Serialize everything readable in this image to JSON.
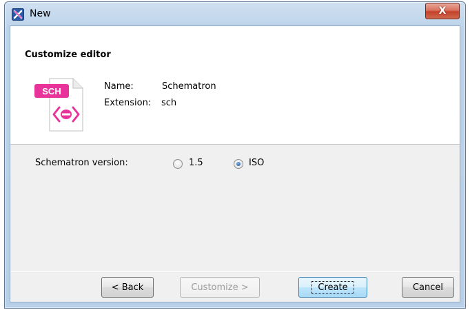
{
  "window": {
    "title": "New",
    "close_label": "X"
  },
  "header": {
    "title": "Customize editor",
    "icon_badge": "SCH",
    "name_label": "Name:",
    "name_value": "Schematron",
    "extension_label": "Extension:",
    "extension_value": "sch"
  },
  "options": {
    "version_label": "Schematron version:",
    "radios": [
      {
        "label": "1.5",
        "checked": false
      },
      {
        "label": "ISO",
        "checked": true
      }
    ]
  },
  "buttons": {
    "back": "< Back",
    "customize": "Customize >",
    "create": "Create",
    "cancel": "Cancel"
  },
  "colors": {
    "accent_pink": "#e8339b",
    "titlebar": "#bcd3ea",
    "close": "#c4412a"
  }
}
